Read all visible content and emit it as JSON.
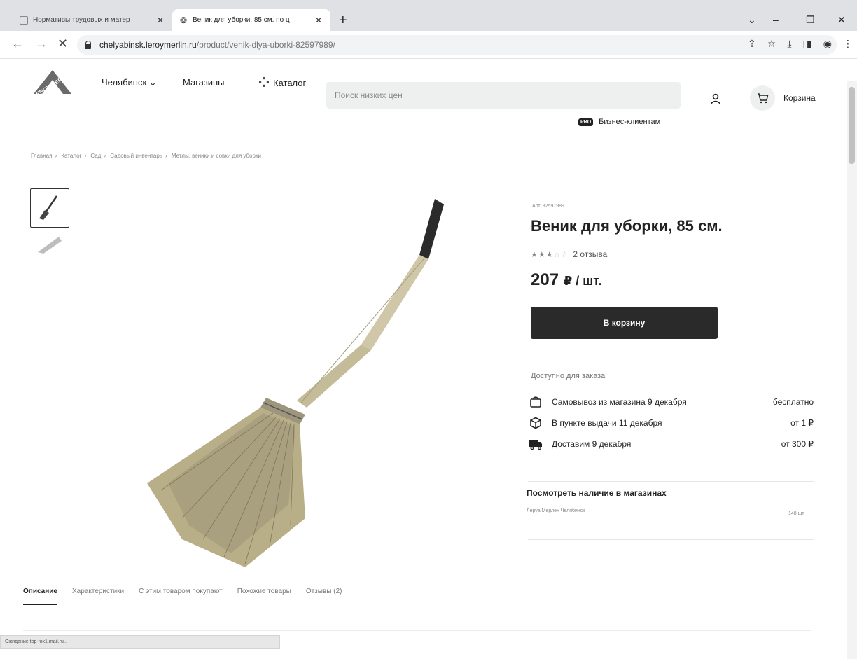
{
  "browser": {
    "tabs": [
      {
        "title": "Нормативы трудовых и матер",
        "active": false
      },
      {
        "title": "Веник для уборки, 85 см. по ц",
        "active": true
      }
    ],
    "new_tab": "+",
    "url_host": "chelyabinsk.leroymerlin.ru",
    "url_path": "/product/venik-dlya-uborki-82597989/",
    "status": "Ожидание top-fox1.mail.ru..."
  },
  "header": {
    "city": "Челябинск",
    "stores": "Магазины",
    "catalog": "Каталог",
    "search_placeholder": "Поиск низких цен",
    "cart": "Корзина",
    "pro_badge": "PRO",
    "business": "Бизнес-клиентам"
  },
  "breadcrumb": [
    "Главная",
    "Каталог",
    "Сад",
    "Садовый инвентарь",
    "Метлы, веники и совки для уборки"
  ],
  "product": {
    "article": "Арт. 82597989",
    "title": "Веник для уборки, 85 см.",
    "rating": 3,
    "rating_max": 5,
    "reviews": "2 отзыва",
    "price": "207",
    "price_unit": "₽ / шт.",
    "buy_label": "В корзину",
    "availability_heading": "Доступно для заказа",
    "delivery": [
      {
        "icon": "bag-icon",
        "label": "Самовывоз из магазина 9 декабря",
        "price": "бесплатно"
      },
      {
        "icon": "box-icon",
        "label": "В пункте выдачи 11 декабря",
        "price": "от 1 ₽"
      },
      {
        "icon": "truck-icon",
        "label": "Доставим 9 декабря",
        "price": "от 300 ₽"
      }
    ],
    "stock_heading": "Посмотреть наличие в магазинах",
    "stock_store": "Леруа Мерлен Челябинск",
    "stock_qty": "148 шт"
  },
  "tabs": [
    {
      "label": "Описание",
      "active": true
    },
    {
      "label": "Характеристики",
      "active": false
    },
    {
      "label": "С этим товаром покупают",
      "active": false
    },
    {
      "label": "Похожие товары",
      "active": false
    },
    {
      "label": "Отзывы (2)",
      "active": false
    }
  ]
}
